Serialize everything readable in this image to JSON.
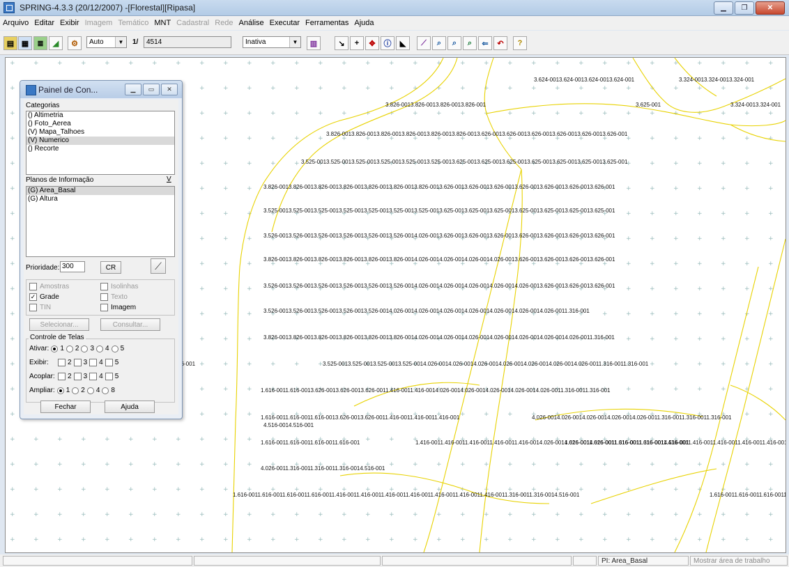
{
  "window": {
    "title": "SPRING-4.3.3 (20/12/2007) -[Florestal][Ripasa]"
  },
  "menu": [
    {
      "label": "Arquivo",
      "enabled": true
    },
    {
      "label": "Editar",
      "enabled": true
    },
    {
      "label": "Exibir",
      "enabled": true
    },
    {
      "label": "Imagem",
      "enabled": false
    },
    {
      "label": "Temático",
      "enabled": false
    },
    {
      "label": "MNT",
      "enabled": true
    },
    {
      "label": "Cadastral",
      "enabled": false
    },
    {
      "label": "Rede",
      "enabled": false
    },
    {
      "label": "Análise",
      "enabled": true
    },
    {
      "label": "Executar",
      "enabled": true
    },
    {
      "label": "Ferramentas",
      "enabled": true
    },
    {
      "label": "Ajuda",
      "enabled": true
    }
  ],
  "toolbar": {
    "mode_select": "Auto",
    "scale_prefix": "1/",
    "scale_value": "4514",
    "state_select": "Inativa"
  },
  "panel": {
    "title": "Painel de Con...",
    "categories_label": "Categorias",
    "categories": [
      {
        "label": "() Altimetria",
        "selected": false
      },
      {
        "label": "() Foto_Aerea",
        "selected": false
      },
      {
        "label": "(V) Mapa_Talhoes",
        "selected": false
      },
      {
        "label": "(V) Numerico",
        "selected": true
      },
      {
        "label": "() Recorte",
        "selected": false
      }
    ],
    "planes_label": "Planos de Informação",
    "planes_toggle": "V",
    "planes": [
      {
        "label": "(G) Area_Basal",
        "selected": true
      },
      {
        "label": "(G) Altura",
        "selected": false
      }
    ],
    "priority_label": "Prioridade:",
    "priority_value": "300",
    "cr_button": "CR",
    "checks": {
      "amostras": "Amostras",
      "isolinhas": "Isolinhas",
      "grade": "Grade",
      "texto": "Texto",
      "tin": "TIN",
      "imagem": "Imagem"
    },
    "select_button": "Selecionar...",
    "consult_button": "Consultar...",
    "screens_group": "Controle de Telas",
    "ativar_label": "Ativar:",
    "exibir_label": "Exibir:",
    "acoplar_label": "Acoplar:",
    "ampliar_label": "Ampliar:",
    "screen_nums": [
      "1",
      "2",
      "3",
      "4",
      "5"
    ],
    "zoom_opts": [
      "1",
      "2",
      "4",
      "8"
    ],
    "close_button": "Fechar",
    "help_button": "Ajuda"
  },
  "grid_labels": [
    "3.624-0013.624-0013.624-0013.624-001",
    "3.324-0013.324-0013.324-001",
    "3.826-0013.826-0013.826-0013.826-001",
    "3.625-001",
    "3.324-0013.324-001",
    "3.826-0013.826-0013.826-0013.826-0013.826-0013.826-0013.626-0013.626-0013.626-0013.626-0013.626-0013.626-001",
    "3.525-0013.525-0013.525-0013.525-0013.525-0013.525-0013.625-0013.625-0013.625-0013.625-0013.625-0013.625-0013.625-001",
    "3.826-0013.826-0013.826-0013.826-0013.826-0013.826-0013.826-0013.626-0013.626-0013.626-0013.626-0013.626-0013.626-0013.626-001",
    "3.525-0013.525-0013.525-0013.525-0013.525-0013.525-0013.525-0013.625-0013.625-0013.625-0013.625-0013.625-0013.625-0013.625-001",
    "3.526-0013.526-0013.526-0013.526-0013.526-0013.526-0014.026-0013.626-0013.626-0013.626-0013.626-0013.626-0013.626-0013.626-001",
    "3.826-0013.826-0013.826-0013.826-0013.826-0013.826-0014.026-0014.026-0014.026-0014.026-0013.626-0013.626-0013.626-0013.626-001",
    "3.526-0013.526-0013.526-0013.526-0013.526-0013.526-0014.026-0014.026-0014.026-0014.026-0014.026-0013.626-0013.626-0013.626-001",
    "3.526-0013.526-0013.526-0013.526-0013.526-0014.026-0014.026-0014.026-0014.026-0014.026-0014.026-0014.026-0011.316-001",
    "3.826-0013.826-0013.826-0013.826-0013.826-0013.826-0014.026-0014.026-0014.026-0014.026-0014.026-0014.026-0014.026-0011.316-001",
    "1.616-001",
    "3.525-0013.525-0013.525-0013.525-0014.026-0014.026-0014.026-0014.026-0014.026-0014.026-0014.026-0011.316-0011.316-001",
    "1.616-0011.616-0013.626-0013.626-0013.626-0011.416-0011.416-0014.026-0014.026-0014.026-0014.026-0014.026-0011.316-0011.316-001",
    "1.616-0011.616-0011.616-0013.626-0013.626-0011.416-0011.416-0011.416-001",
    "4.026-0014.026-0014.026-0014.026-0014.026-0011.316-0011.316-0011.316-001",
    "1.616-0011.616-0011.616-0011.616-001",
    "1.416-0011.416-0011.416-0011.416-0011.416-0014.026-0014.026-0014.026-0011.316-0011.316-0014.516-001",
    "1.616-0011.616-0011.616-0011.616-0011.416-0011.416-0011.416-0011.416-0011.416-001",
    "4.026-0011.316-0011.316-0011.316-0014.516-001",
    "1.616-0011.616-0011.616-0011.616-0011.416-0011.416-0011.416-0011.416-0011.416-0011.416-0011.416-0011.316-0011.316-0014.516-001",
    "1.616-0011.616-0011.616-0011.616-0011.416-0011.416-0011.416-0011.416-0011.416-0011.416-0011.416-0011.316-001",
    "4.516-0014.516-001"
  ],
  "status": {
    "pi": "PI: Area_Basal",
    "hint": "Mostrar área de trabalho"
  }
}
